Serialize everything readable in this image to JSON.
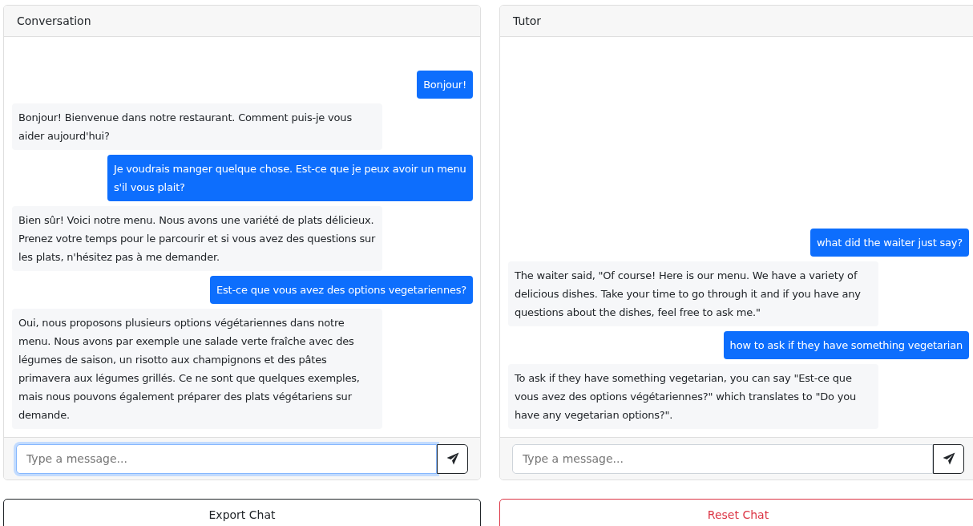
{
  "panels": [
    {
      "title": "Conversation",
      "messages": [
        {
          "kind": "user",
          "text": "Bonjour!"
        },
        {
          "kind": "bot",
          "text": "Bonjour! Bienvenue dans notre restaurant. Comment puis-je vous aider aujourd'hui?"
        },
        {
          "kind": "user",
          "text": "Je voudrais manger quelque chose. Est-ce que je peux avoir un menu s'il vous plait?"
        },
        {
          "kind": "bot",
          "text": "Bien sûr! Voici notre menu. Nous avons une variété de plats délicieux. Prenez votre temps pour le parcourir et si vous avez des questions sur les plats, n'hésitez pas à me demander."
        },
        {
          "kind": "user",
          "text": "Est-ce que vous avez des options vegetariennes?"
        },
        {
          "kind": "bot",
          "text": "Oui, nous proposons plusieurs options végétariennes dans notre menu. Nous avons par exemple une salade verte fraîche avec des légumes de saison, un risotto aux champignons et des pâtes primavera aux légumes grillés. Ce ne sont que quelques exemples, mais nous pouvons également préparer des plats végétariens sur demande."
        }
      ],
      "input": {
        "placeholder": "Type a message...",
        "focused": true
      }
    },
    {
      "title": "Tutor",
      "messages": [
        {
          "kind": "user",
          "text": "what did the waiter just say?"
        },
        {
          "kind": "bot",
          "text": "The waiter said, \"Of course! Here is our menu. We have a variety of delicious dishes. Take your time to go through it and if you have any questions about the dishes, feel free to ask me.\""
        },
        {
          "kind": "user",
          "text": "how to ask if they have something vegetarian"
        },
        {
          "kind": "bot",
          "text": "To ask if they have something vegetarian, you can say \"Est-ce que vous avez des options végétariennes?\" which translates to \"Do you have any vegetarian options?\"."
        }
      ],
      "input": {
        "placeholder": "Type a message...",
        "focused": false
      }
    }
  ],
  "actions": [
    {
      "label": "Export Chat",
      "kind": "export"
    },
    {
      "label": "Reset Chat",
      "kind": "reset"
    }
  ]
}
